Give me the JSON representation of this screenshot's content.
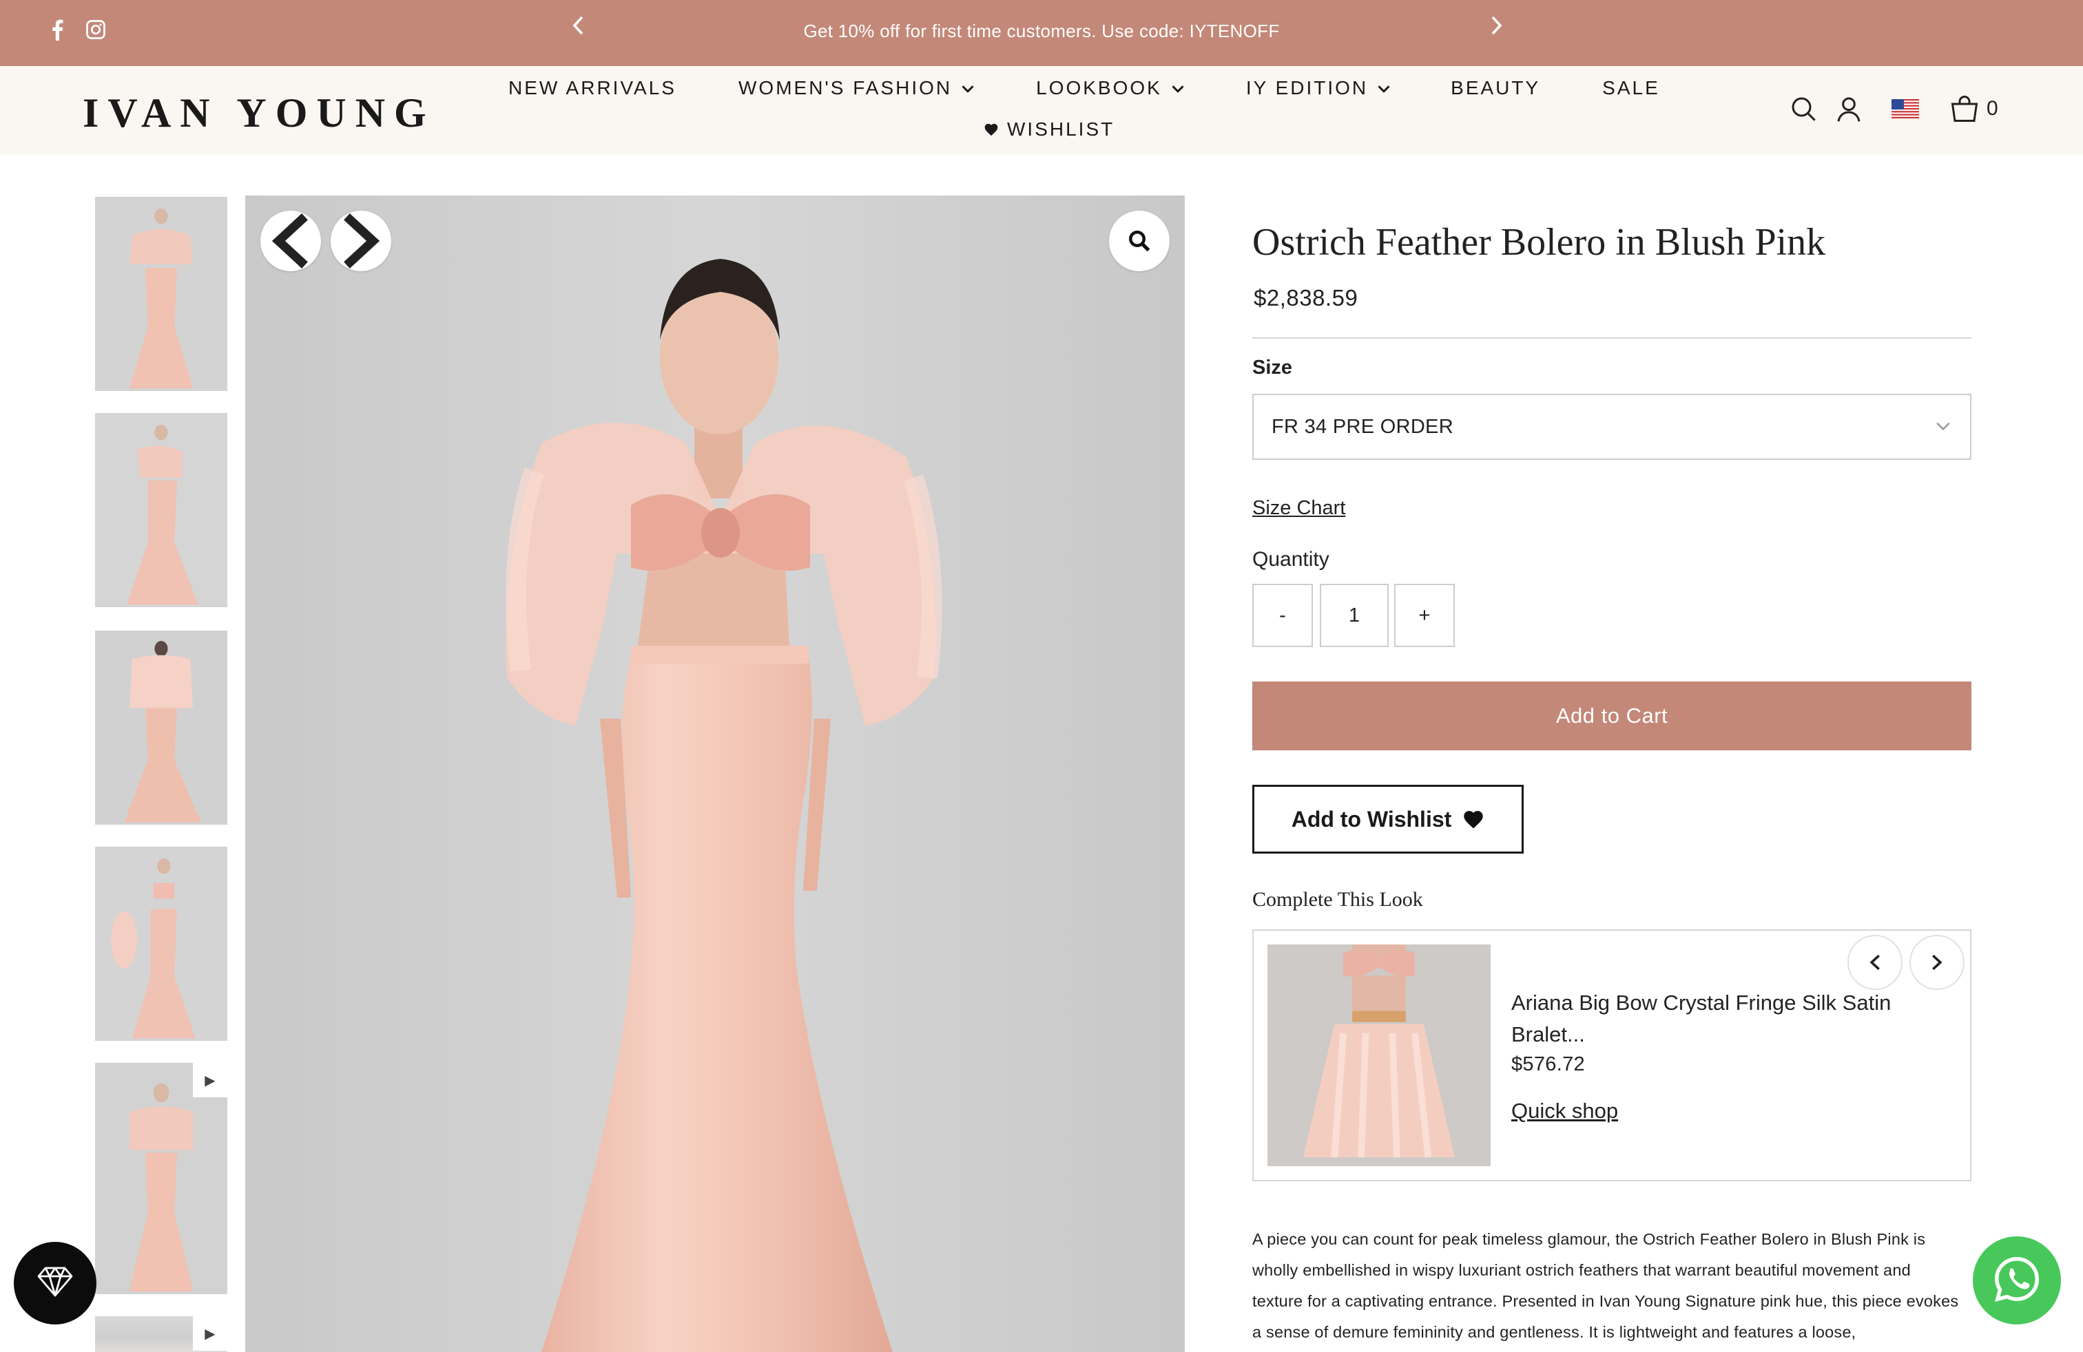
{
  "announcement": {
    "text": "Get 10% off for first time customers. Use code: IYTENOFF",
    "prev_icon": "chevron-left-icon",
    "next_icon": "chevron-right-icon",
    "social": [
      "facebook-icon",
      "instagram-icon"
    ],
    "background": "#c38878"
  },
  "header": {
    "logo": "IVAN YOUNG",
    "nav": [
      {
        "label": "NEW ARRIVALS",
        "dropdown": false
      },
      {
        "label": "WOMEN'S FASHION",
        "dropdown": true
      },
      {
        "label": "LOOKBOOK",
        "dropdown": true
      },
      {
        "label": "IY EDITION",
        "dropdown": true
      },
      {
        "label": "BEAUTY",
        "dropdown": false
      },
      {
        "label": "SALE",
        "dropdown": false
      }
    ],
    "wishlist": "WISHLIST",
    "cart_count": "0",
    "icons": [
      "search-icon",
      "account-icon",
      "us-flag-icon",
      "cart-icon"
    ]
  },
  "gallery": {
    "thumbnails": 6,
    "video_thumbnails": [
      5,
      6
    ],
    "prev_icon": "chevron-left-icon",
    "next_icon": "chevron-right-icon",
    "zoom_icon": "zoom-icon"
  },
  "product": {
    "title": "Ostrich Feather Bolero in Blush Pink",
    "price": "$2,838.59",
    "size_label": "Size",
    "size_value": "FR 34 PRE ORDER",
    "size_chart": "Size Chart",
    "quantity_label": "Quantity",
    "qty_minus": "-",
    "qty_value": "1",
    "qty_plus": "+",
    "add_to_cart": "Add to Cart",
    "add_to_wishlist": "Add to Wishlist"
  },
  "complete_look": {
    "heading": "Complete This Look",
    "item_name": "Ariana Big Bow Crystal Fringe Silk Satin Bralet...",
    "item_price": "$576.72",
    "quick_shop": "Quick shop"
  },
  "description": "A piece you can count for peak timeless glamour, the Ostrich Feather Bolero in Blush Pink is wholly embellished in wispy luxuriant ostrich feathers that warrant beautiful movement and texture for a captivating entrance. Presented in Ivan Young Signature pink hue, this piece evokes a sense of demure femininity and gentleness. It is lightweight and features a loose,",
  "floating": {
    "left_icon": "diamond-icon",
    "right_icon": "whatsapp-icon",
    "whatsapp_color": "#48c85a"
  }
}
